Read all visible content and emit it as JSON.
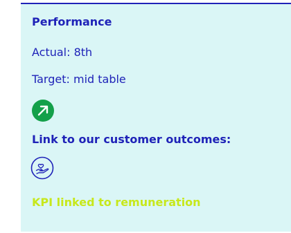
{
  "card": {
    "title": "Performance",
    "actual": "Actual: 8th",
    "target": "Target: mid table",
    "trend_icon": "arrow-up-right-icon",
    "outcomes_heading": "Link to our customer outcomes:",
    "outcome_icon": "hand-heart-icon",
    "kpi_note": "KPI linked to remuneration"
  },
  "colors": {
    "panel_bg": "#daf6f6",
    "accent_blue": "#1f23b8",
    "trend_green": "#14a04a",
    "kpi_lime": "#c7e81b"
  }
}
